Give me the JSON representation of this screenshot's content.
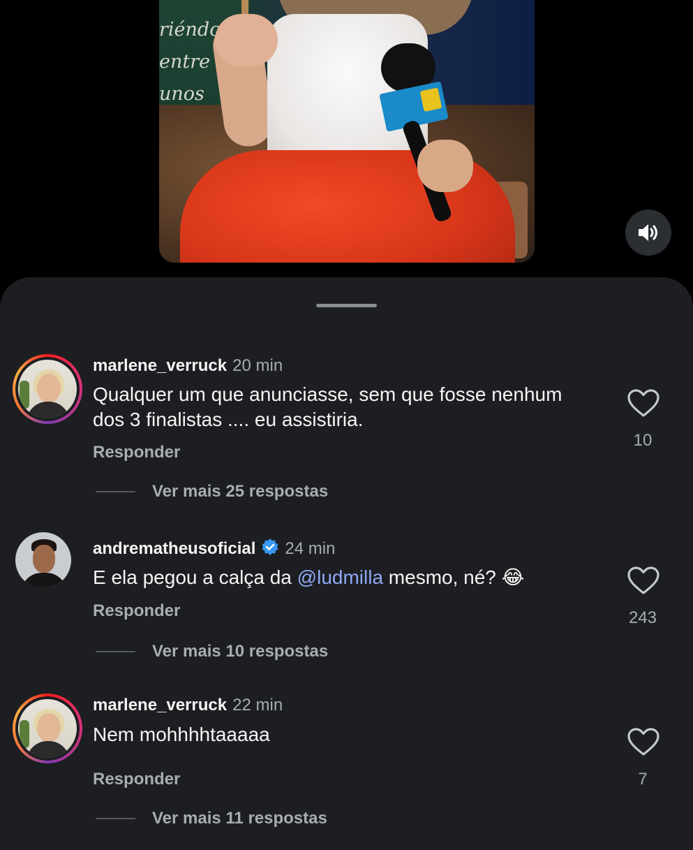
{
  "video": {
    "board_lines": [
      "riéndote",
      "entre",
      "unos"
    ]
  },
  "comments": [
    {
      "username": "marlene_verruck",
      "time": "20 min",
      "text": "Qualquer um que anunciasse, sem que fosse nenhum dos 3 finalistas .... eu assistiria.",
      "reply_label": "Responder",
      "likes": "10",
      "more_label": "Ver mais 25 respostas"
    },
    {
      "username": "andrematheusoficial",
      "verified": true,
      "time": "24 min",
      "text_before": "E ela pegou a calça da ",
      "mention": "@ludmilla",
      "text_after": " mesmo, né? 😂",
      "reply_label": "Responder",
      "likes": "243",
      "more_label": "Ver mais 10 respostas"
    },
    {
      "username": "marlene_verruck",
      "time": "22 min",
      "text": "Nem mohhhhtaaaaa",
      "reply_label": "Responder",
      "likes": "7",
      "more_label": "Ver mais 11 respostas"
    }
  ],
  "colors": {
    "background": "#000000",
    "sheet": "#1c1e21",
    "secondary_text": "#a8acb2",
    "mention": "#8fa9f5",
    "verified": "#3897f0"
  }
}
